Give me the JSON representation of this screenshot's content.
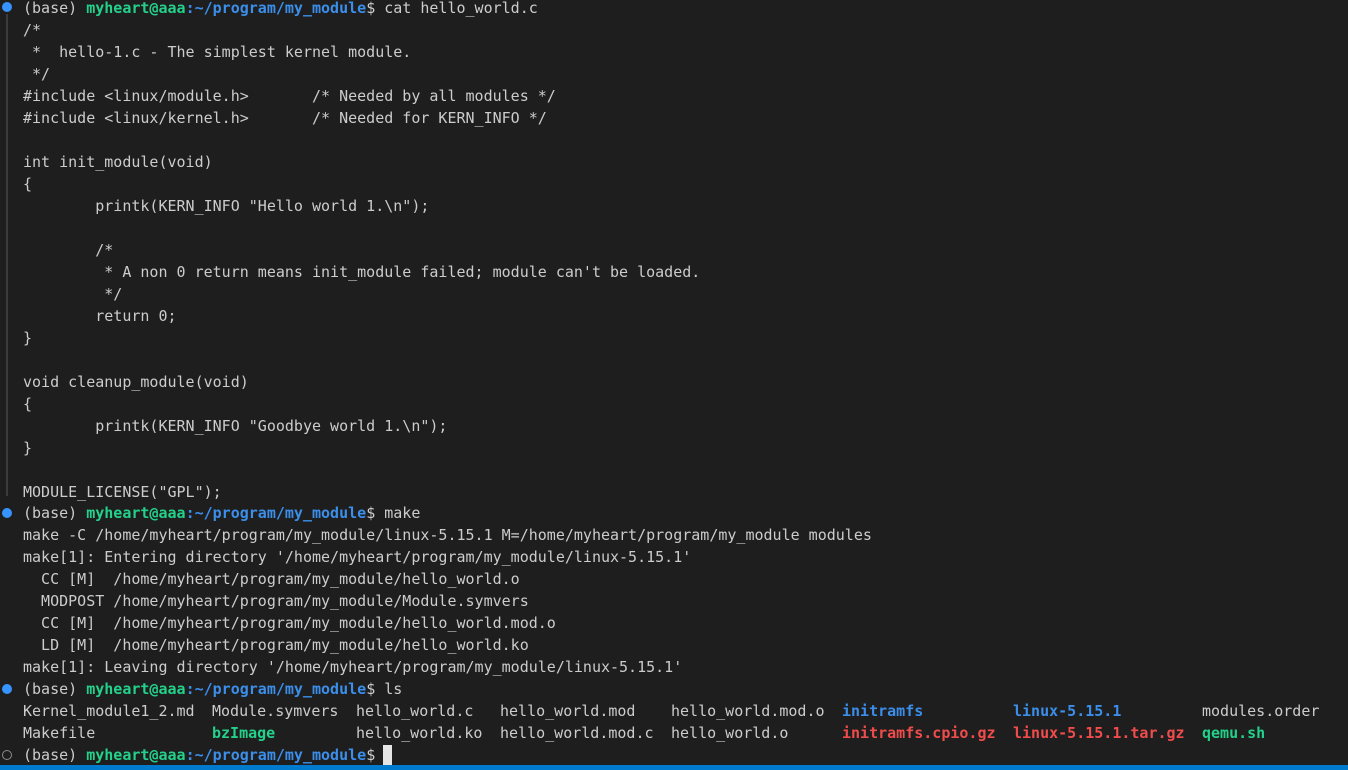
{
  "prompt": {
    "env": "(base) ",
    "user_host": "myheart@aaa",
    "path": ":~/program/my_module",
    "dollar": "$ "
  },
  "commands": {
    "cat": "cat hello_world.c",
    "make": "make",
    "ls": "ls"
  },
  "source_lines": [
    "/*",
    " *  hello-1.c - The simplest kernel module.",
    " */",
    "#include <linux/module.h>       /* Needed by all modules */",
    "#include <linux/kernel.h>       /* Needed for KERN_INFO */",
    "",
    "int init_module(void)",
    "{",
    "        printk(KERN_INFO \"Hello world 1.\\n\");",
    "",
    "        /*",
    "         * A non 0 return means init_module failed; module can't be loaded.",
    "         */",
    "        return 0;",
    "}",
    "",
    "void cleanup_module(void)",
    "{",
    "        printk(KERN_INFO \"Goodbye world 1.\\n\");",
    "}",
    "",
    "MODULE_LICENSE(\"GPL\");"
  ],
  "make_output": [
    "make -C /home/myheart/program/my_module/linux-5.15.1 M=/home/myheart/program/my_module modules",
    "make[1]: Entering directory '/home/myheart/program/my_module/linux-5.15.1'",
    "  CC [M]  /home/myheart/program/my_module/hello_world.o",
    "  MODPOST /home/myheart/program/my_module/Module.symvers",
    "  CC [M]  /home/myheart/program/my_module/hello_world.mod.o",
    "  LD [M]  /home/myheart/program/my_module/hello_world.ko",
    "make[1]: Leaving directory '/home/myheart/program/my_module/linux-5.15.1'"
  ],
  "ls_row1": [
    "Kernel_module1_2.md",
    "Module.symvers",
    "hello_world.c",
    "hello_world.mod",
    "hello_world.mod.o",
    "initramfs",
    "linux-5.15.1",
    "modules.order"
  ],
  "ls_row2": [
    "Makefile",
    "bzImage",
    "hello_world.ko",
    "hello_world.mod.c",
    "hello_world.o",
    "initramfs.cpio.gz",
    "linux-5.15.1.tar.gz",
    "qemu.sh"
  ],
  "colors": {
    "background": "#1e1e1e",
    "text": "#cccccc",
    "user_host": "#23d18b",
    "path": "#3b8eea",
    "archive": "#f14c4c",
    "status_bar": "#007acc"
  }
}
